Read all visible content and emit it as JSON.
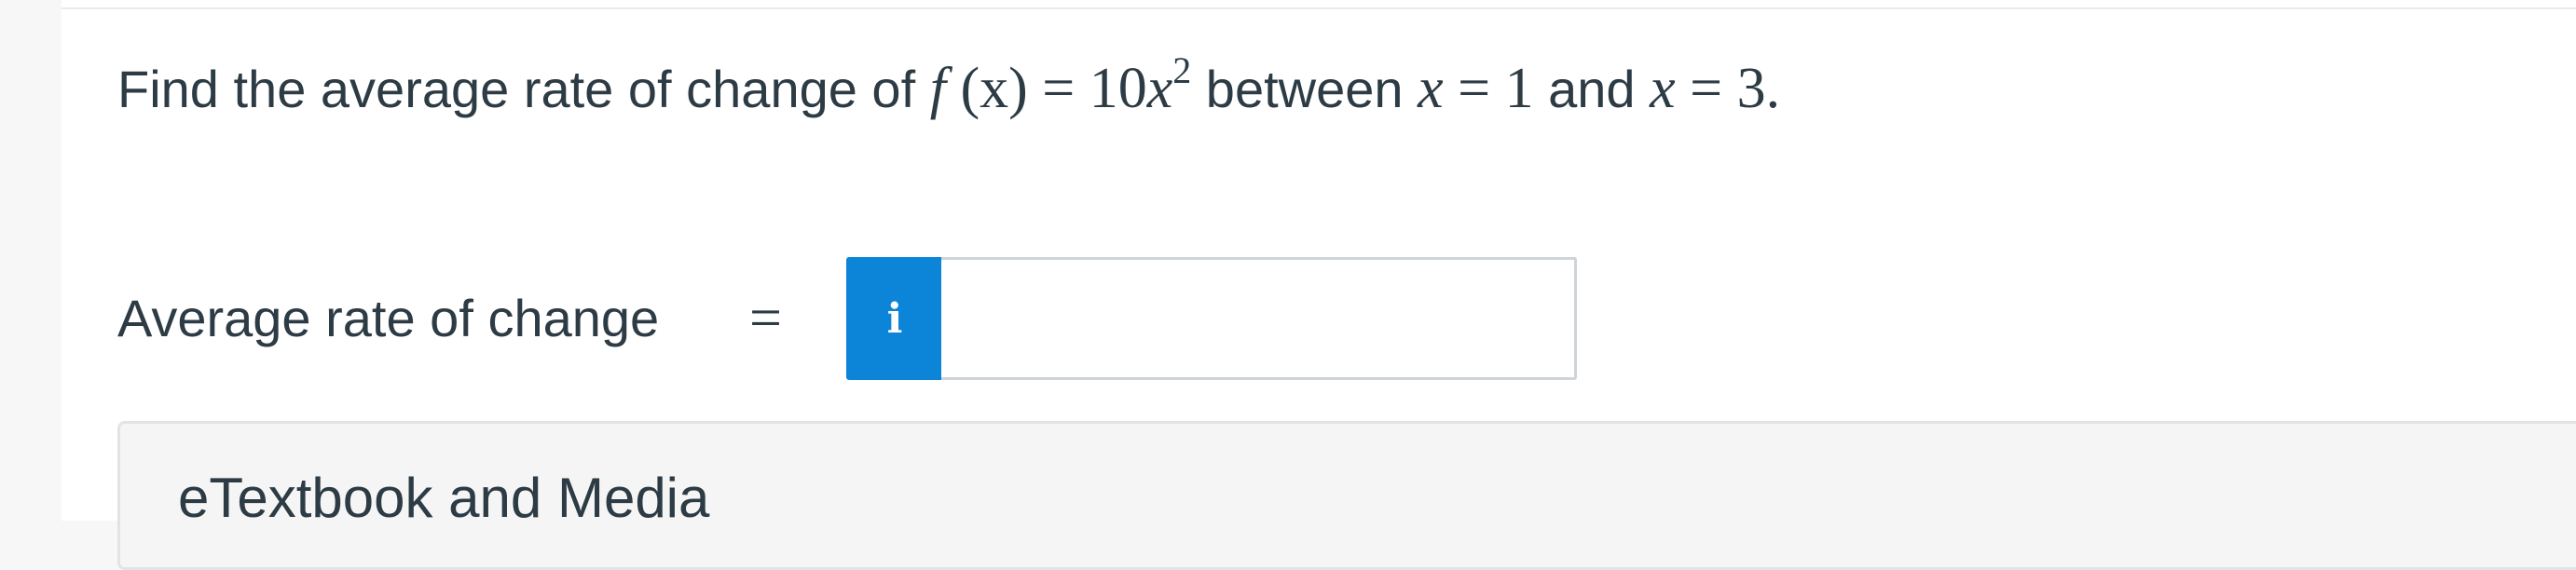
{
  "question": {
    "prefix": "Find the average rate of change of ",
    "function_name": "f",
    "function_arg": " (x) ",
    "eq1": "= ",
    "coefficient": "10",
    "variable": "x",
    "exponent": "2",
    "between": " between ",
    "x1_var": "x",
    "x1_eq": " = 1",
    "and": " and ",
    "x2_var": "x",
    "x2_eq": " = 3."
  },
  "answer": {
    "label": "Average rate of change",
    "equals": "=",
    "info_icon": "i",
    "input_value": ""
  },
  "resources": {
    "title": "eTextbook and Media"
  }
}
